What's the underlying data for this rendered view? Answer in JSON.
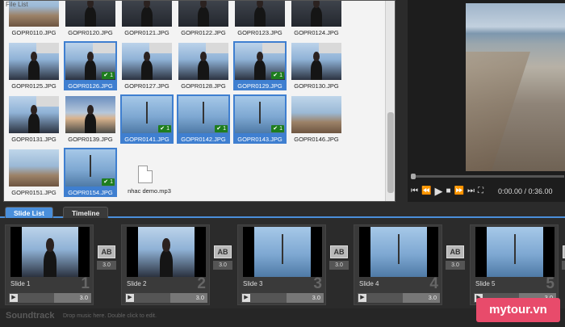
{
  "file_list": {
    "title": "File List",
    "items": [
      {
        "name": "GOPR0110.JPG",
        "look": "beach",
        "selected": false,
        "check": "",
        "kind": "image"
      },
      {
        "name": "GOPR0120.JPG",
        "look": "dark",
        "selected": false,
        "check": "",
        "kind": "image"
      },
      {
        "name": "GOPR0121.JPG",
        "look": "dark",
        "selected": false,
        "check": "",
        "kind": "image"
      },
      {
        "name": "GOPR0122.JPG",
        "look": "dark",
        "selected": false,
        "check": "",
        "kind": "image"
      },
      {
        "name": "GOPR0123.JPG",
        "look": "dark",
        "selected": false,
        "check": "",
        "kind": "image"
      },
      {
        "name": "GOPR0124.JPG",
        "look": "dark",
        "selected": false,
        "check": "",
        "kind": "image"
      },
      {
        "name": "GOPR0125.JPG",
        "look": "sky",
        "selected": false,
        "check": "",
        "kind": "image"
      },
      {
        "name": "GOPR0126.JPG",
        "look": "sky",
        "selected": true,
        "check": "✔ 1",
        "kind": "image"
      },
      {
        "name": "GOPR0127.JPG",
        "look": "sky",
        "selected": false,
        "check": "",
        "kind": "image"
      },
      {
        "name": "GOPR0128.JPG",
        "look": "sky",
        "selected": false,
        "check": "",
        "kind": "image"
      },
      {
        "name": "GOPR0129.JPG",
        "look": "sky",
        "selected": true,
        "check": "✔ 1",
        "kind": "image"
      },
      {
        "name": "GOPR0130.JPG",
        "look": "sky",
        "selected": false,
        "check": "",
        "kind": "image"
      },
      {
        "name": "GOPR0131.JPG",
        "look": "sky",
        "selected": false,
        "check": "",
        "kind": "image"
      },
      {
        "name": "GOPR0139.JPG",
        "look": "sunset",
        "selected": false,
        "check": "",
        "kind": "image"
      },
      {
        "name": "GOPR0141.JPG",
        "look": "sea",
        "selected": true,
        "check": "✔ 1",
        "kind": "image"
      },
      {
        "name": "GOPR0142.JPG",
        "look": "sea",
        "selected": true,
        "check": "✔ 1",
        "kind": "image"
      },
      {
        "name": "GOPR0143.JPG",
        "look": "sea",
        "selected": true,
        "check": "✔ 1",
        "kind": "image"
      },
      {
        "name": "GOPR0146.JPG",
        "look": "beach",
        "selected": false,
        "check": "",
        "kind": "image"
      },
      {
        "name": "GOPR0151.JPG",
        "look": "beach",
        "selected": false,
        "check": "",
        "kind": "image"
      },
      {
        "name": "GOPR0154.JPG",
        "look": "sea",
        "selected": true,
        "check": "✔ 1",
        "kind": "image"
      },
      {
        "name": "nhac demo.mp3",
        "look": "",
        "selected": false,
        "check": "",
        "kind": "audio"
      }
    ]
  },
  "preview": {
    "time": "0:00.00 / 0:36.00",
    "progress": 0,
    "controls": {
      "skip_back": "⏮",
      "rewind": "⏪",
      "play": "▶",
      "stop": "■",
      "forward": "⏩",
      "skip_forward": "⏭",
      "fullscreen": "⛶"
    }
  },
  "tabs": [
    {
      "label": "Slide List",
      "active": true
    },
    {
      "label": "Timeline",
      "active": false
    }
  ],
  "slides": [
    {
      "title": "Slide 1",
      "number": "1",
      "duration": "3.0",
      "transition_duration": "3.0",
      "look": "sky"
    },
    {
      "title": "Slide 2",
      "number": "2",
      "duration": "3.0",
      "transition_duration": "3.0",
      "look": "sky"
    },
    {
      "title": "Slide 3",
      "number": "3",
      "duration": "3.0",
      "transition_duration": "3.0",
      "look": "sea"
    },
    {
      "title": "Slide 4",
      "number": "4",
      "duration": "3.0",
      "transition_duration": "3.0",
      "look": "sea"
    },
    {
      "title": "Slide 5",
      "number": "5",
      "duration": "3.0",
      "transition_duration": "3.0",
      "look": "sea"
    }
  ],
  "transition_label": "AB",
  "soundtrack": {
    "label": "Soundtrack",
    "hint": "Drop music here. Double click to edit."
  },
  "watermark": "mytour.vn",
  "colors": {
    "accent": "#4a8fdb",
    "selection": "#3f7fd0",
    "check": "#1e7d1e",
    "watermark": "#e84b6b"
  }
}
